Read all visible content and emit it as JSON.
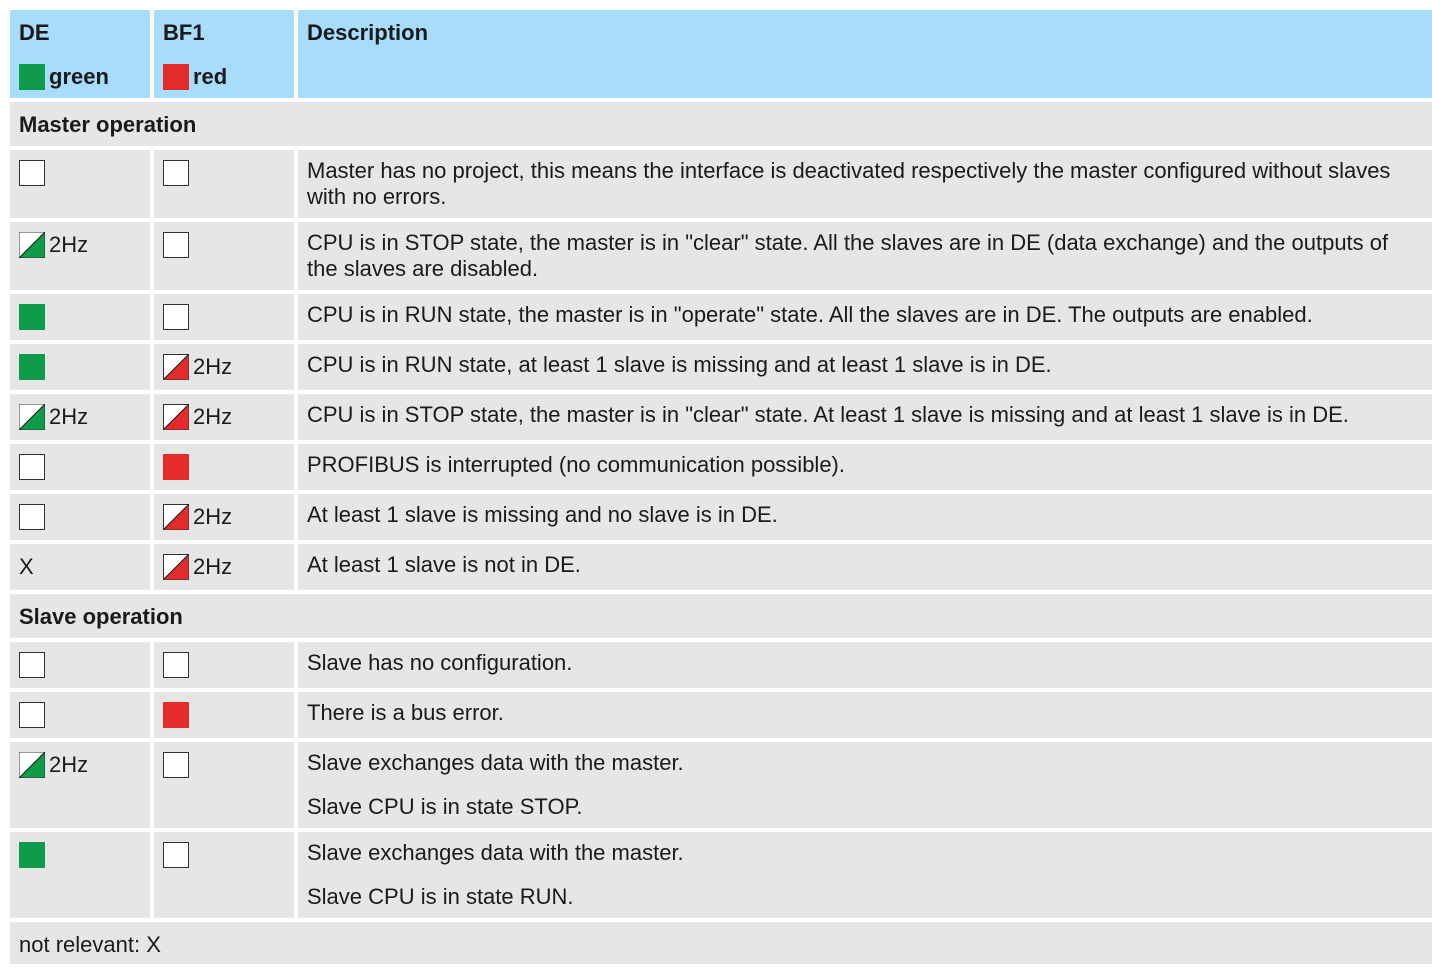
{
  "header": {
    "col1_title": "DE",
    "col1_color_label": "green",
    "col1_color": "#0f9c4a",
    "col2_title": "BF1",
    "col2_color_label": "red",
    "col2_color": "#e32b2b",
    "col3_title": "Description",
    "header_bg": "#a8dcfb"
  },
  "sections": {
    "master": "Master operation",
    "slave": "Slave operation"
  },
  "freq_label": "2Hz",
  "x_label": "X",
  "rows": {
    "m1": {
      "desc": "Master has no project, this means the interface is deactivated respectively the master configured without slaves with no errors."
    },
    "m2": {
      "desc": "CPU is in STOP state, the master is in \"clear\" state. All the slaves are in DE (data exchange) and the outputs of the slaves are disabled."
    },
    "m3": {
      "desc": "CPU is in RUN state, the master is in \"operate\" state. All the slaves are in DE. The outputs are enabled."
    },
    "m4": {
      "desc": "CPU is in RUN state, at least 1 slave is missing and at least 1 slave is in DE."
    },
    "m5": {
      "desc": "CPU is in STOP state, the master is in \"clear\" state. At least 1 slave is missing and at least 1 slave is in DE."
    },
    "m6": {
      "desc": "PROFIBUS is interrupted (no communication possible)."
    },
    "m7": {
      "desc": "At least 1 slave is missing and no slave is in DE."
    },
    "m8": {
      "desc": "At least 1 slave is not in DE."
    },
    "s1": {
      "desc": "Slave has no configuration."
    },
    "s2": {
      "desc": "There is a bus error."
    },
    "s3": {
      "desc1": "Slave exchanges data with the master.",
      "desc2": "Slave CPU is in state STOP."
    },
    "s4": {
      "desc1": "Slave exchanges data with the master.",
      "desc2": "Slave CPU is in state RUN."
    }
  },
  "footer": "not relevant: X"
}
